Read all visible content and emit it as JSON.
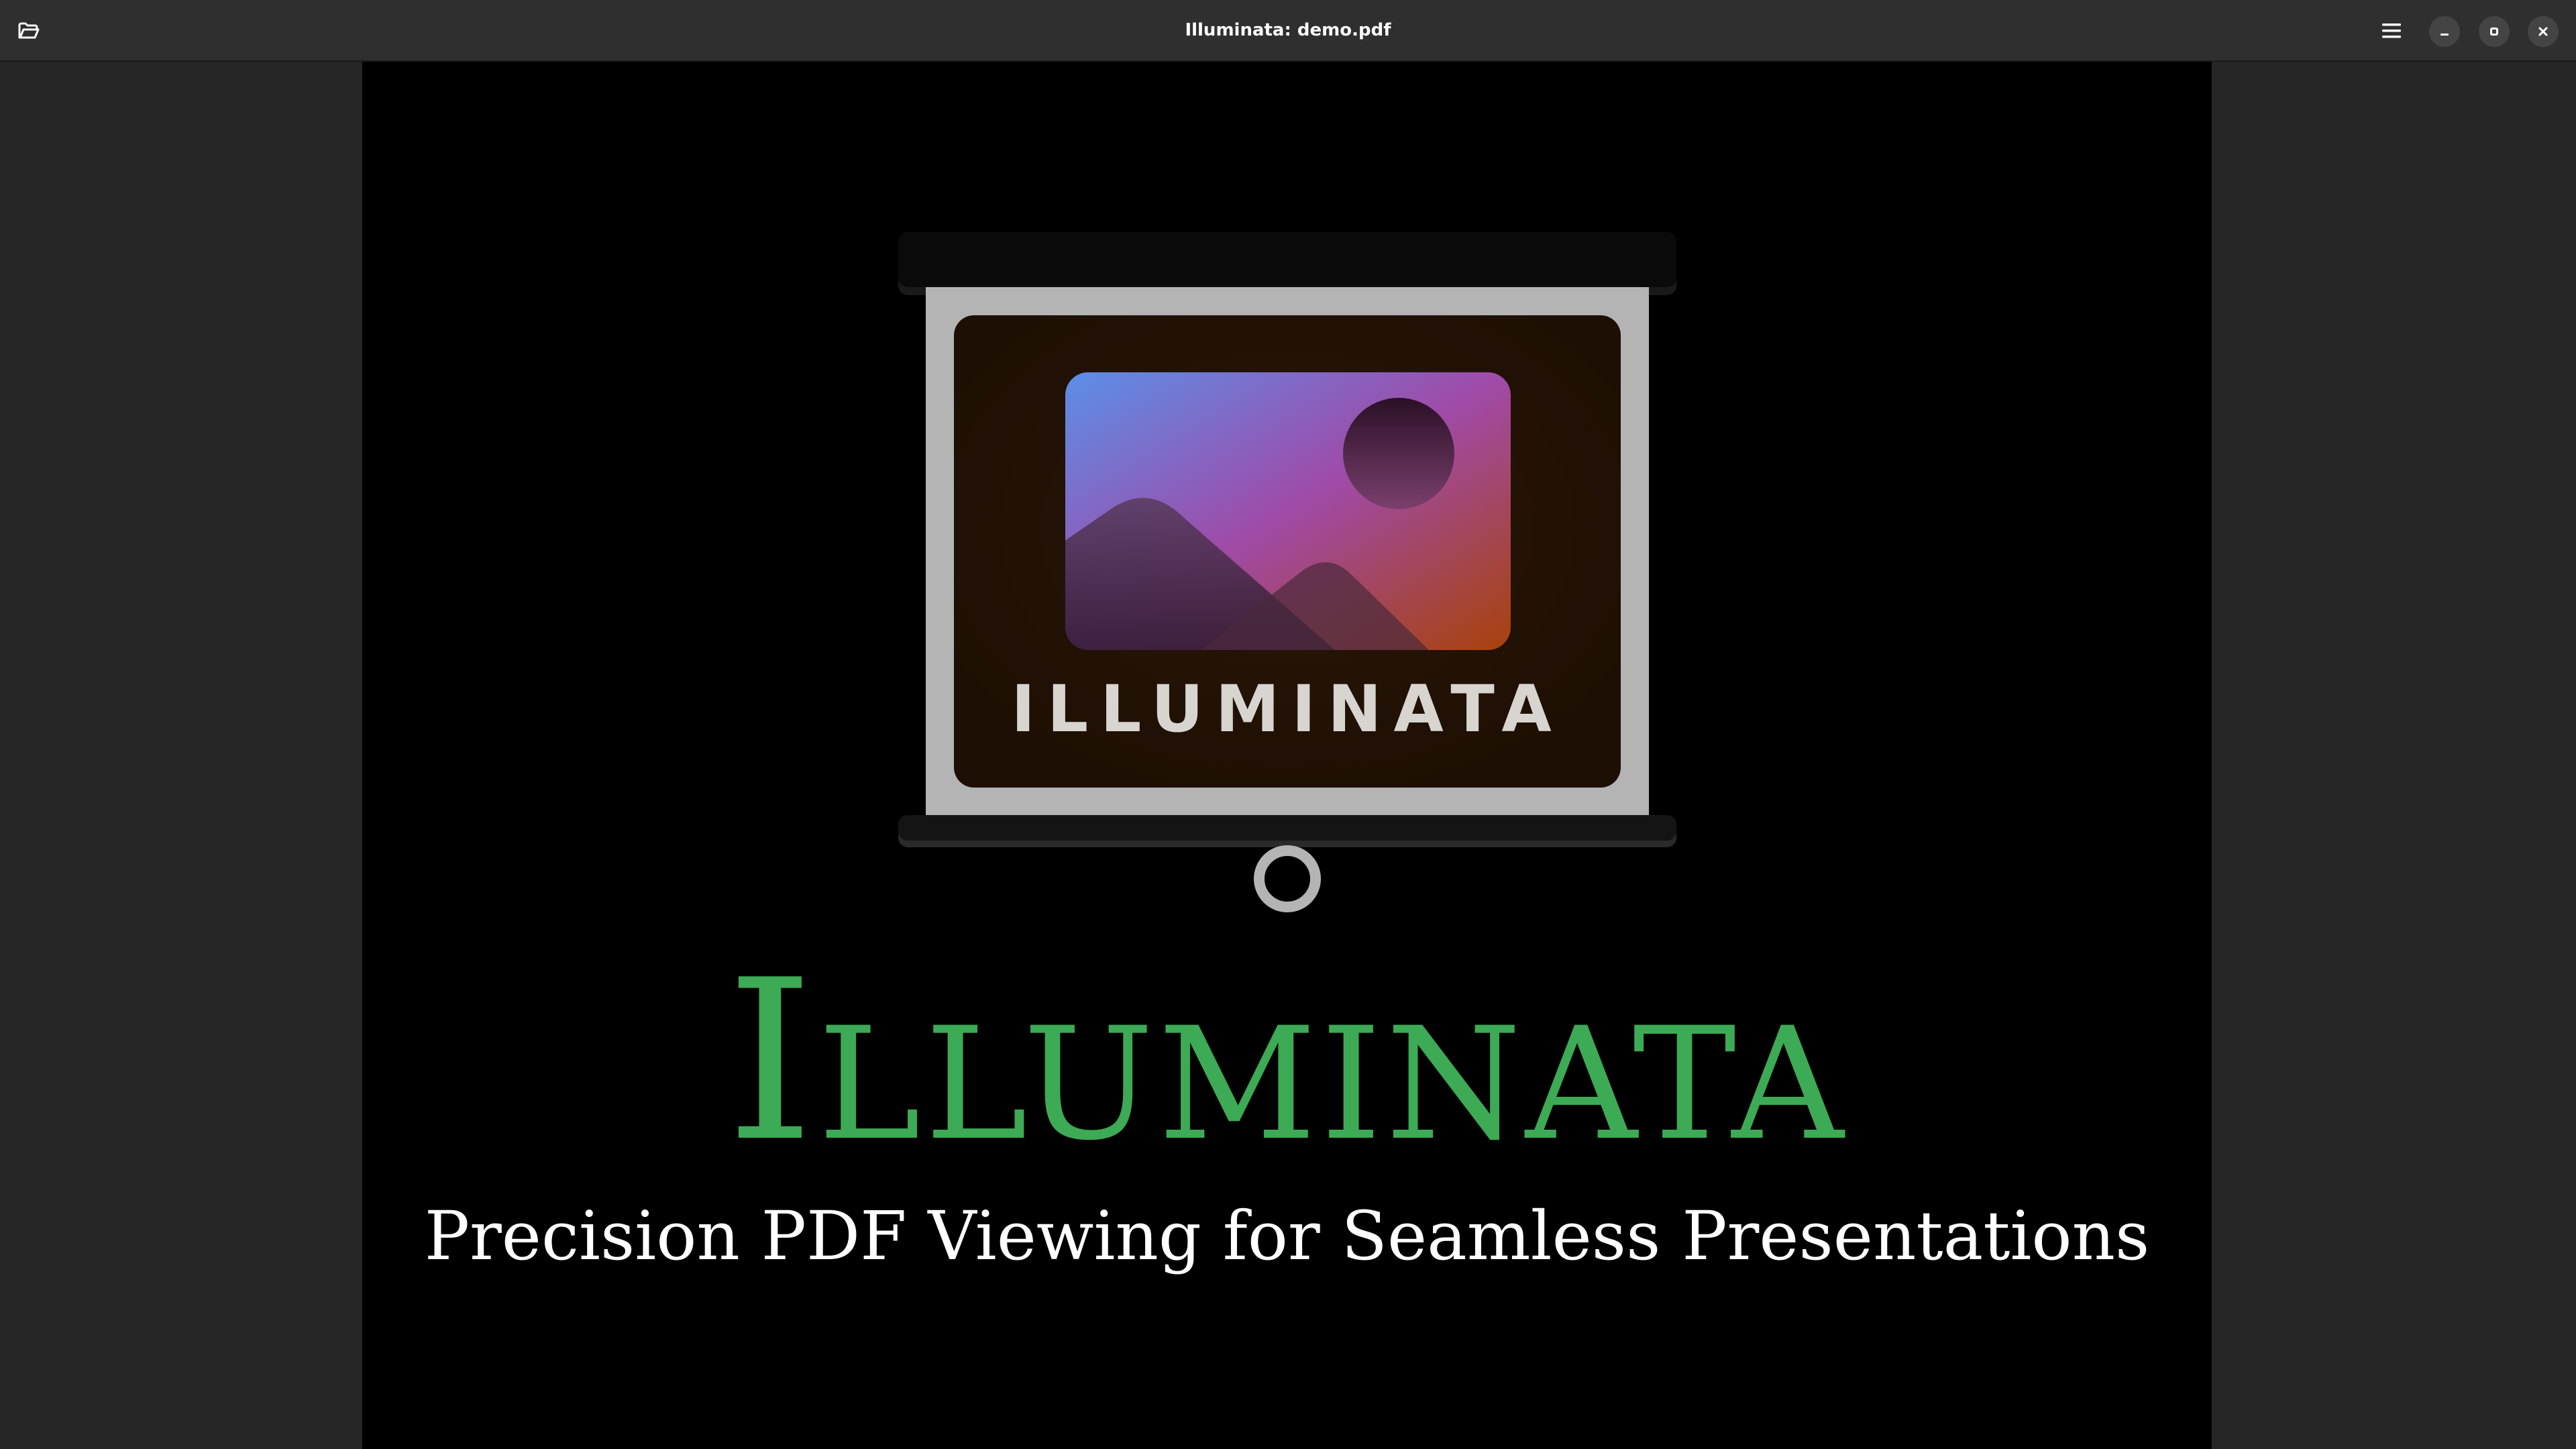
{
  "window": {
    "title": "Illuminata: demo.pdf",
    "buttons": {
      "open_icon": "folder-open-icon",
      "menu_icon": "hamburger-menu-icon",
      "minimize_icon": "minimize-icon",
      "maximize_icon": "maximize-icon",
      "close_icon": "close-icon"
    }
  },
  "document": {
    "logo_text": "ILLUMINATA",
    "title": "Illuminata",
    "subtitle": "Precision PDF Viewing for Seamless Presentations",
    "colors": {
      "title": "#3daa55",
      "subtitle": "#ffffff",
      "page_background": "#000000",
      "viewer_background": "#262626"
    }
  }
}
